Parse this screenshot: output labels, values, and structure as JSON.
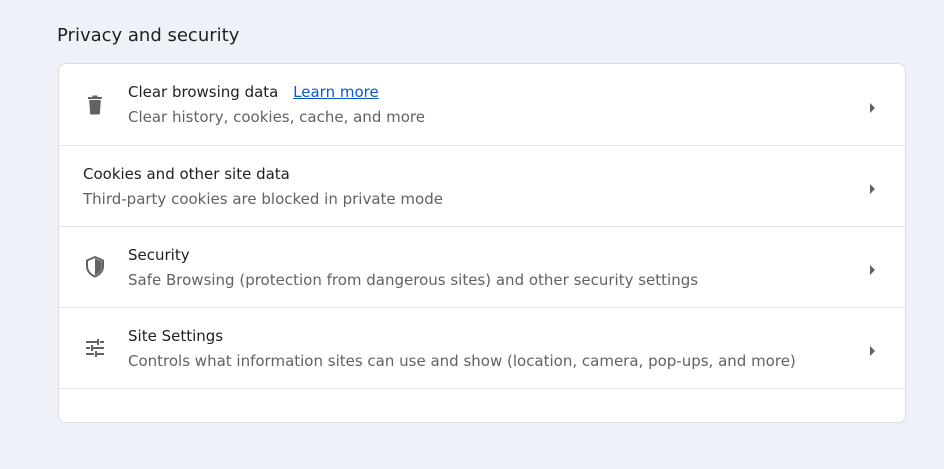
{
  "section": {
    "title": "Privacy and security"
  },
  "rows": [
    {
      "title": "Clear browsing data",
      "link": "Learn more",
      "subtitle": "Clear history, cookies, cache, and more",
      "icon": "trash-icon"
    },
    {
      "title": "Cookies and other site data",
      "subtitle": "Third-party cookies are blocked in private mode"
    },
    {
      "title": "Security",
      "subtitle": "Safe Browsing (protection from dangerous sites) and other security settings",
      "icon": "shield-icon"
    },
    {
      "title": "Site Settings",
      "subtitle": "Controls what information sites can use and show (location, camera, pop-ups, and more)",
      "icon": "sliders-icon"
    }
  ],
  "colors": {
    "background": "#eef2f8",
    "card": "#ffffff",
    "link": "#0b57d0",
    "secondary_text": "#5f6368",
    "icon": "#5f6368"
  }
}
